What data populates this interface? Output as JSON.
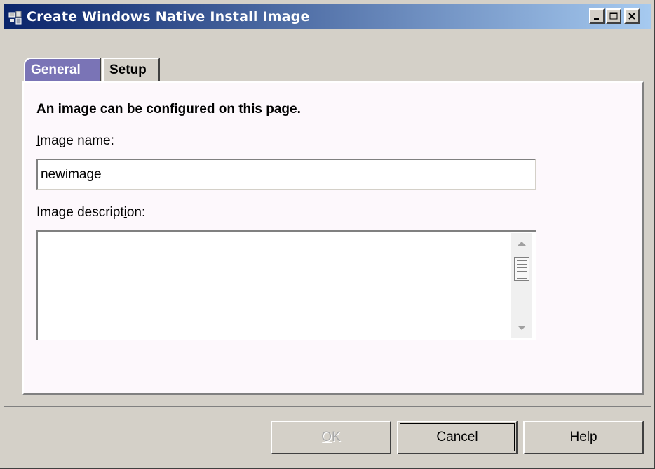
{
  "window": {
    "title": "Create Windows Native Install Image",
    "controls": {
      "minimize": "minimize-icon",
      "maximize": "maximize-icon",
      "close": "close-icon"
    },
    "colors": {
      "titlebar_start": "#0a246a",
      "titlebar_end": "#a6caf0",
      "active_tab": "#7a74b6",
      "panel": "#fdf8fc"
    }
  },
  "tabs": [
    {
      "label": "General",
      "selected": true
    },
    {
      "label": "Setup",
      "selected": false
    }
  ],
  "panel": {
    "heading": "An image can be configured on this page.",
    "image_name_label": "Image name:",
    "image_name_value": "newimage",
    "image_description_label": "Image description:",
    "image_description_value": ""
  },
  "buttons": {
    "ok": "OK",
    "cancel": "Cancel",
    "help": "Help"
  }
}
